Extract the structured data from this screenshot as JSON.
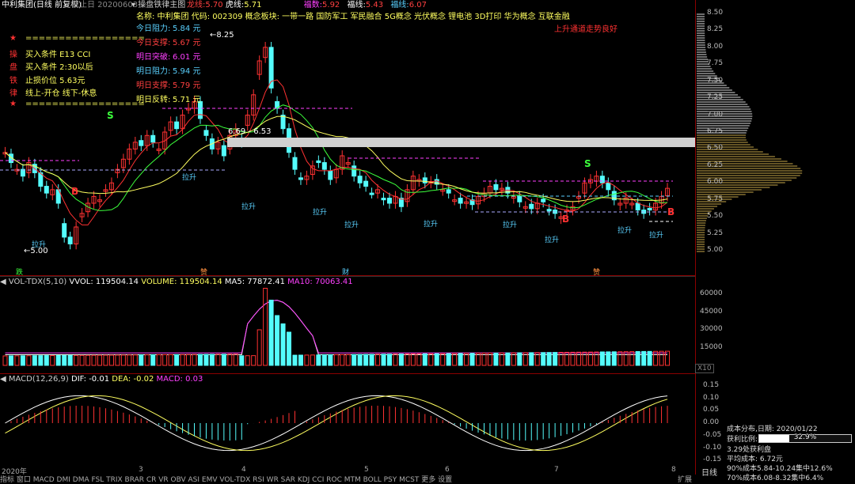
{
  "header": {
    "title": "中利集团(日线 前复权)",
    "date": "截止日 20200603",
    "indicator": "操盘铁律主图",
    "l1_label": "龙线:",
    "l1_value": "5.70",
    "l2_label": "虎线:",
    "l2_value": "5.71",
    "l3_label": "福数:",
    "l3_value": "5.92",
    "l4_label": "福线:",
    "l4_value": "5.43",
    "l5_label": "福线:",
    "l5_value": "6.07"
  },
  "rules": [
    {
      "tag": "★",
      "text": "=================="
    },
    {
      "tag": "操",
      "text": "买入条件 E13 CCI"
    },
    {
      "tag": "盘",
      "text": "买入条件 2:30以后"
    },
    {
      "tag": "铁",
      "text": "止损价位 5.63元"
    },
    {
      "tag": "律",
      "text": "线上-开仓 线下-休息"
    },
    {
      "tag": "★",
      "text": "=================="
    }
  ],
  "stock_info": "名称: 中利集团 代码: 002309 概念板块: 一带一路 国防军工 军民融合 5G概念 光伏概念 锂电池 3D打印 华为概念 互联金融",
  "levels": [
    {
      "label": "今日阻力:",
      "value": "5.84 元",
      "color": "#5ad1ff"
    },
    {
      "label": "今日支撑:",
      "value": "5.67 元",
      "color": "#ff4040"
    },
    {
      "label": "明日突破:",
      "value": "6.01 元",
      "color": "#ff40ff"
    },
    {
      "label": "明日阻力:",
      "value": "5.94 元",
      "color": "#5ad1ff"
    },
    {
      "label": "明日支撑:",
      "value": "5.79 元",
      "color": "#ff4040"
    },
    {
      "label": "明日反转:",
      "value": "5.71 元",
      "color": "#ffff60"
    }
  ],
  "trend_note": "上升通道走势良好",
  "price_scale": [
    "8.50",
    "8.25",
    "8.00",
    "7.75",
    "7.50",
    "7.25",
    "7.00",
    "6.75",
    "6.50",
    "6.25",
    "6.00",
    "5.75",
    "5.50",
    "5.25",
    "5.00"
  ],
  "markers": {
    "high": "8.25",
    "low": "5.00",
    "band": "6.69 - 6.53"
  },
  "signals": [
    "拉升",
    "拉升",
    "拉升",
    "拉升",
    "拉升",
    "拉升",
    "拉升",
    "拉升",
    "拉升",
    "拉升",
    "B",
    "B",
    "B",
    "S",
    "S"
  ],
  "bottom_marks": [
    "跌",
    "赞",
    "财",
    "赞"
  ],
  "volume": {
    "header": "VOL-TDX(5,10)",
    "vvol": "VVOL: 119504.14",
    "vol": "VOLUME: 119504.14",
    "ma5": "MA5: 77872.41",
    "ma10": "MA10: 70063.41",
    "ticks": [
      "60000",
      "45000",
      "30000",
      "15000"
    ],
    "x10": "X10"
  },
  "macd": {
    "header": "MACD(12,26,9)",
    "dif": "DIF: -0.01",
    "dea": "DEA: -0.02",
    "macd": "MACD: 0.03",
    "ticks": [
      "0.15",
      "0.10",
      "0.05",
      "0.00",
      "-0.05",
      "-0.10",
      "-0.15"
    ]
  },
  "axis": {
    "year": "2020年",
    "months": [
      "3",
      "4",
      "5",
      "6",
      "7",
      "8"
    ]
  },
  "side": {
    "title": "成本分布,日期: 2020/01/22",
    "profit_label": "获利比例:",
    "profit_value": "32.9%",
    "profit_pct": 32.9,
    "l1": "3.29处获利盘",
    "l2": "平均成本: 6.72元",
    "l3": "90%成本5.84-10.24集中12.6%",
    "l4": "70%成本6.08-8.32集中6.4%"
  },
  "tabs": "指标 窗口 MACD DMI DMA FSL TRIX BRAR CR VR OBV ASI EMV VOL-TDX RSI WR SAR KDJ CCI ROC MTM BOLL PSY MCST 更多 设置",
  "tabs_right": "扩展",
  "period": "日线",
  "colors": {
    "up": "#ff3232",
    "down": "#54fcfc",
    "ma5": "#ffffff",
    "ma10": "#ffff00",
    "ma20": "#ff40ff"
  }
}
